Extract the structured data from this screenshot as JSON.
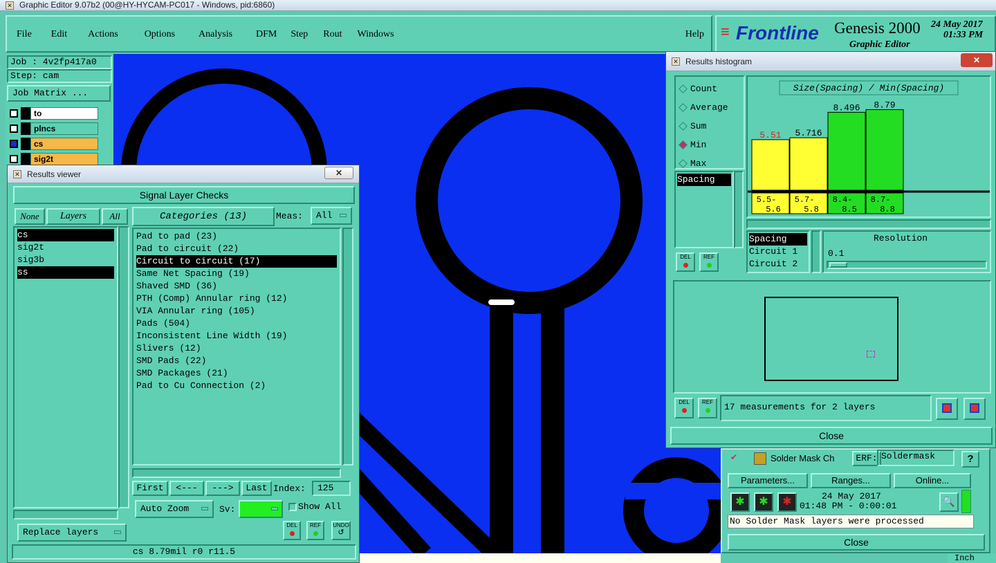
{
  "titlebar": {
    "title": "Graphic Editor 9.07b2 (00@HY-HYCAM-PC017 - Windows, pid:6860)"
  },
  "menu": {
    "items": [
      "File",
      "Edit",
      "Actions",
      "Options",
      "Analysis",
      "DFM",
      "Step",
      "Rout",
      "Windows"
    ],
    "help": "Help"
  },
  "brand": {
    "logo": "Frontline",
    "product": "Genesis 2000",
    "subtitle": "Graphic Editor",
    "date": "24 May 2017",
    "time": "01:33 PM"
  },
  "job": {
    "job_label": "Job : 4v2fp417a0",
    "step_label": "Step: cam",
    "job_matrix": "Job Matrix ..."
  },
  "layer_list": [
    {
      "name": "to",
      "color": "#ffffff"
    },
    {
      "name": "plncs",
      "color": "#5fd0b4"
    },
    {
      "name": "cs",
      "color": "#f7b847"
    },
    {
      "name": "sig2t",
      "color": "#f7b847"
    }
  ],
  "results_viewer": {
    "title": "Results viewer",
    "header": "Signal Layer Checks",
    "none_btn": "None",
    "layers_btn": "Layers",
    "all_btn": "All",
    "categories_label": "Categories (13)",
    "meas_label": "Meas:",
    "meas_value": "All",
    "layers": [
      "cs",
      "sig2t",
      "sig3b",
      "ss"
    ],
    "categories": [
      "Pad to pad (23)",
      "Pad to circuit (22)",
      "Circuit to circuit (17)",
      "Same Net Spacing (19)",
      "Shaved SMD (36)",
      "PTH (Comp) Annular ring (12)",
      "VIA Annular ring (105)",
      "Pads (504)",
      "Inconsistent Line Width (19)",
      "Slivers (12)",
      "SMD Pads (22)",
      "SMD Packages (21)",
      "Pad to Cu Connection (2)"
    ],
    "first": "First",
    "prev": "<---",
    "next": "--->",
    "last": "Last",
    "index_label": "Index:",
    "index_value": "125",
    "auto_zoom": "Auto Zoom",
    "sv_label": "Sv:",
    "show_all": "Show All",
    "replace_layers": "Replace layers",
    "del": "DEL",
    "ref": "REF",
    "undo": "UNDO",
    "status": "cs 8.79mil  r0  r11.5"
  },
  "histogram": {
    "title": "Results histogram",
    "modes": [
      "Count",
      "Average",
      "Sum",
      "Min",
      "Max"
    ],
    "selected_mode": "Min",
    "chart_title": "Size(Spacing) / Min(Spacing)",
    "spacing_list": [
      "Spacing"
    ],
    "del": "DEL",
    "ref": "REF",
    "sublist": [
      "Spacing",
      "Circuit 1",
      "Circuit 2"
    ],
    "resolution_label": "Resolution",
    "resolution_value": "0.1",
    "measure_text": "17 measurements for 2 layers",
    "close": "Close"
  },
  "chart_data": {
    "type": "bar",
    "title": "Size(Spacing) / Min(Spacing)",
    "categories": [
      "5.5-5.6",
      "5.7-5.8",
      "8.4-8.5",
      "8.7-8.8"
    ],
    "values": [
      5.51,
      5.716,
      8.496,
      8.79
    ],
    "value_labels": [
      "5.51",
      "5.716",
      "8.496",
      "8.79"
    ],
    "bar_colors": [
      "#ffff33",
      "#ffff33",
      "#22dd22",
      "#22dd22"
    ],
    "ylim": [
      0,
      9.2
    ]
  },
  "soldermask": {
    "name": "Solder Mask Ch",
    "erf_label": "ERF:",
    "erf_value": "Soldermask",
    "help": "?",
    "parameters": "Parameters...",
    "ranges": "Ranges...",
    "online": "Online...",
    "date": "24 May 2017",
    "time": "01:48 PM - 0:00:01",
    "message": "No Solder Mask layers were processed",
    "close": "Close"
  },
  "bottom_right": {
    "unit": "Inch"
  }
}
